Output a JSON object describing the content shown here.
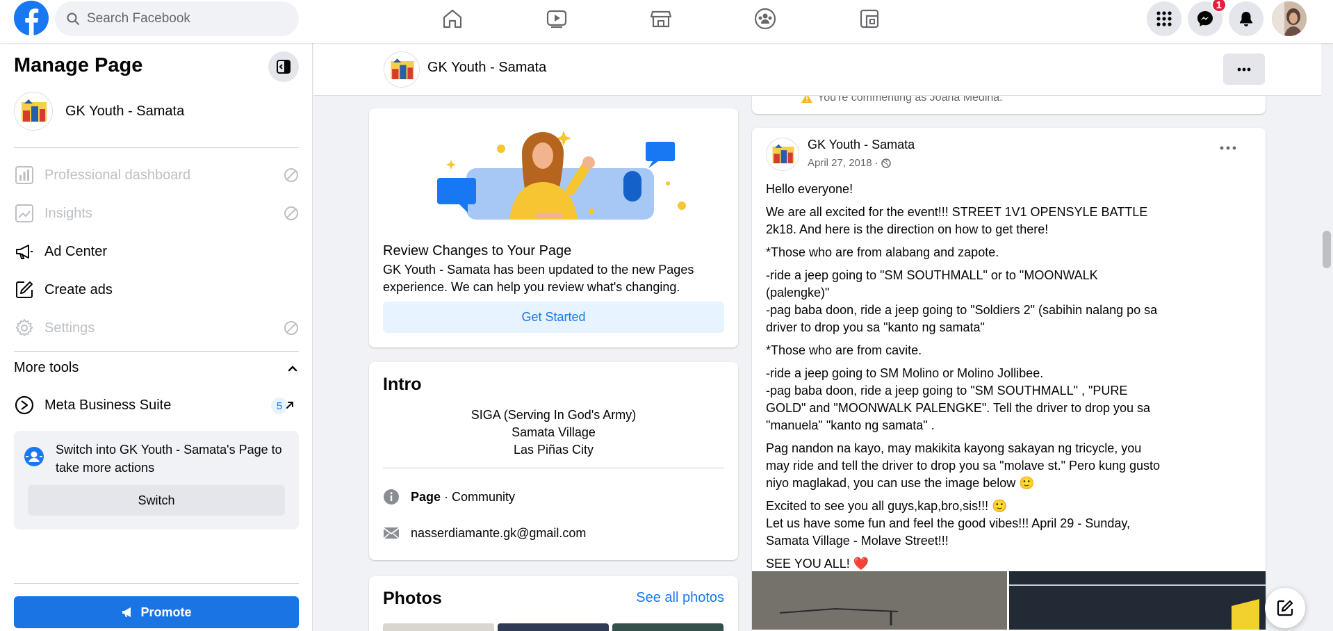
{
  "topbar": {
    "search_placeholder": "Search Facebook",
    "messenger_badge": "1",
    "nav_icons": [
      "home-icon",
      "watch-icon",
      "marketplace-icon",
      "groups-icon",
      "gaming-icon"
    ]
  },
  "sidebar": {
    "title": "Manage Page",
    "page_name": "GK Youth - Samata",
    "items": [
      {
        "label": "Professional dashboard",
        "disabled": true,
        "icon": "dashboard-icon"
      },
      {
        "label": "Insights",
        "disabled": true,
        "icon": "insights-icon"
      },
      {
        "label": "Ad Center",
        "disabled": false,
        "icon": "megaphone-icon"
      },
      {
        "label": "Create ads",
        "disabled": false,
        "icon": "edit-icon"
      },
      {
        "label": "Settings",
        "disabled": true,
        "icon": "gear-icon"
      }
    ],
    "more_tools_label": "More tools",
    "business_suite_label": "Meta Business Suite",
    "business_suite_count": "5",
    "switch_text": "Switch into GK Youth - Samata's Page to take more actions",
    "switch_button": "Switch",
    "promote_button": "Promote"
  },
  "page_header": {
    "name": "GK Youth - Samata"
  },
  "review_card": {
    "title": "Review Changes to Your Page",
    "description": "GK Youth - Samata has been updated to the new Pages experience. We can help you review what's changing.",
    "button": "Get Started"
  },
  "intro": {
    "title": "Intro",
    "bio_line1": "SIGA (Serving In God's Army)",
    "bio_line2": "Samata Village",
    "bio_line3": "Las Piñas City",
    "page_type_bold": "Page",
    "page_type_rest": " · Community",
    "email": "nasserdiamante.gk@gmail.com"
  },
  "photos": {
    "title": "Photos",
    "see_all": "See all photos"
  },
  "comment_notice": "You're commenting as Joana Medina.",
  "post": {
    "author": "GK Youth - Samata",
    "date": "April 27, 2018 ·",
    "paragraphs": [
      "Hello everyone!",
      "We are all excited for the event!!! STREET 1V1 OPENSYLE BATTLE 2k18. And here is the direction on how to get there!",
      "*Those who are from alabang and zapote.",
      "-ride a jeep going to \"SM SOUTHMALL\" or to \"MOONWALK (palengke)\"\n-pag baba doon, ride a jeep going to \"Soldiers 2\" (sabihin nalang po sa driver to drop you sa \"kanto ng samata\"",
      "*Those who are from cavite.",
      "-ride a jeep going to SM Molino or Molino Jollibee.\n-pag baba doon, ride a jeep going to \"SM SOUTHMALL\" , \"PURE GOLD\" and \"MOONWALK PALENGKE\". Tell the driver to drop you sa \"manuela\" \"kanto ng samata\"  .",
      "Pag nandon na kayo, may makikita kayong sakayan ng tricycle, you may ride and tell the driver to drop you sa \"molave st.\" Pero kung gusto niyo maglakad, you can use the image below 🙂",
      "Excited to see you all guys,kap,bro,sis!!! 🙂\nLet us have some fun and feel the good vibes!!! April 29 - Sunday, Samata Village - Molave Street!!!",
      "SEE YOU ALL! ❤️"
    ]
  },
  "colors": {
    "brand": "#1877f2",
    "promote": "#1b74e4",
    "badge": "#e41e3f"
  }
}
